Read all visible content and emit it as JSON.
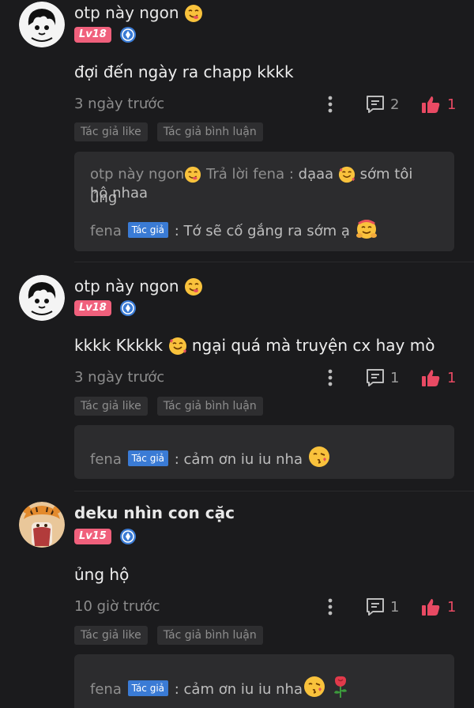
{
  "comments": [
    {
      "username": "otp này ngon",
      "level": "Lv18",
      "text_a": "đợi đến ngày ra chapp kkkk",
      "text_b": "",
      "time": "3 ngày trước",
      "reply_count": "2",
      "like_count": "1",
      "tags": [
        "Tác giả like",
        "Tác giả bình luận"
      ],
      "replies": [
        {
          "author": "otp này ngon",
          "verb": "Trả lời fena :",
          "text_a": "dạaa",
          "text_b": "sớm tôi ủng",
          "text_c": "hộ nhaa"
        },
        {
          "author": "fena",
          "badge": "Tác giả",
          "text": ": Tớ sẽ cố gắng ra sớm ạ"
        }
      ]
    },
    {
      "username": "otp này ngon",
      "level": "Lv18",
      "text_a": "kkkk Kkkkk",
      "text_b": "ngại quá mà truyện cx hay mò",
      "time": "3 ngày trước",
      "reply_count": "1",
      "like_count": "1",
      "tags": [
        "Tác giả like",
        "Tác giả bình luận"
      ],
      "replies": [
        {
          "author": "fena",
          "badge": "Tác giả",
          "text": ": cảm ơn iu iu nha"
        }
      ]
    },
    {
      "username": "deku nhìn con cặc",
      "level": "Lv15",
      "text_a": "ủng hộ",
      "text_b": "",
      "time": "10 giờ trước",
      "reply_count": "1",
      "like_count": "1",
      "tags": [
        "Tác giả like",
        "Tác giả bình luận"
      ],
      "replies": [
        {
          "author": "fena",
          "badge": "Tác giả",
          "text": ": cảm ơn iu iu nha"
        }
      ]
    }
  ],
  "colors": {
    "level_badge": "#f0607c",
    "author_badge": "#3a7bd5",
    "like": "#e84a63",
    "background": "#1b1b1d"
  }
}
